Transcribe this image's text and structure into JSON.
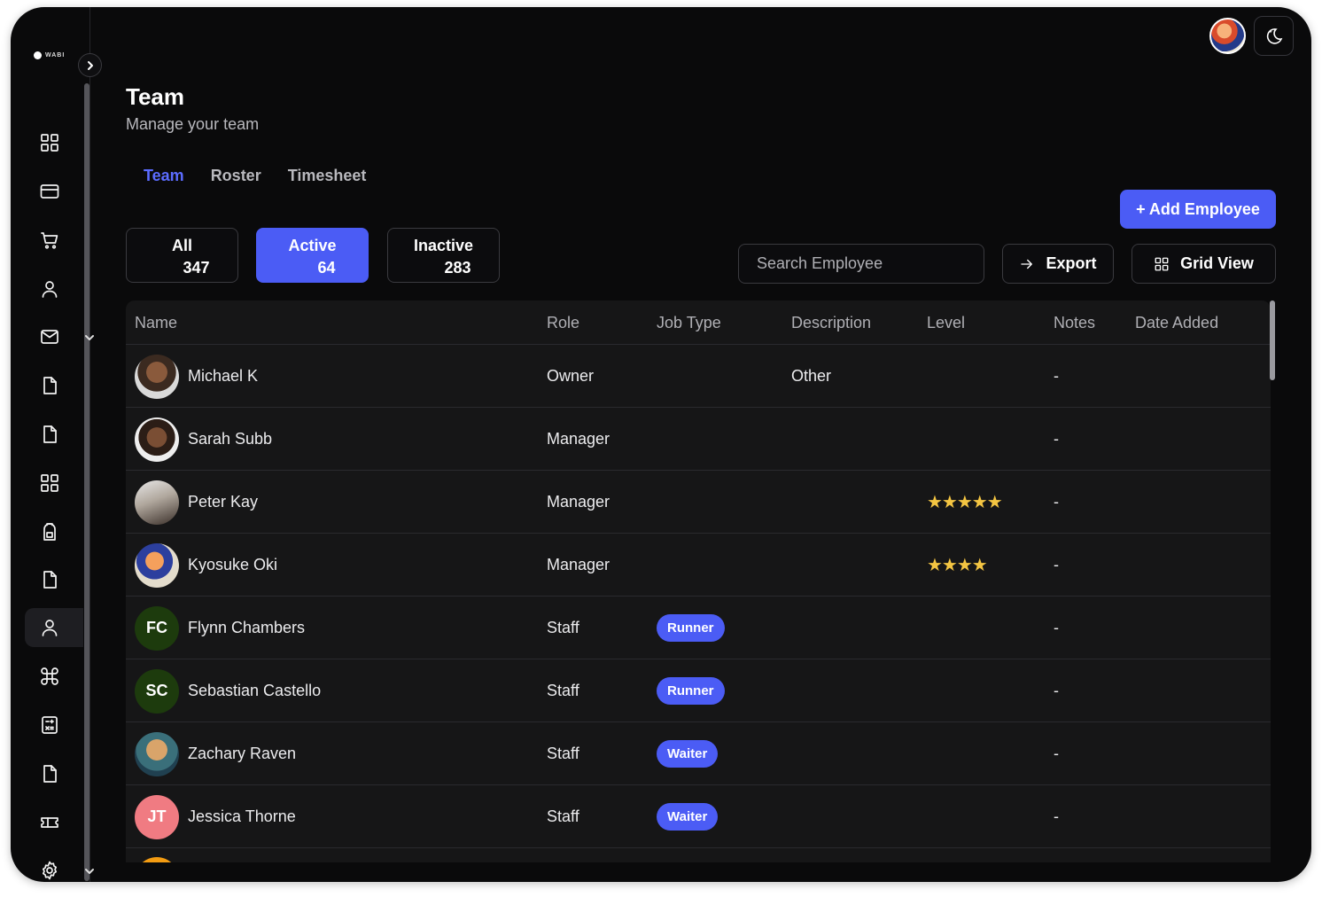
{
  "brand": {
    "logo_text": "WABI"
  },
  "header": {
    "title": "Team",
    "subtitle": "Manage your team"
  },
  "tabs": [
    {
      "label": "Team",
      "active": true
    },
    {
      "label": "Roster",
      "active": false
    },
    {
      "label": "Timesheet",
      "active": false
    }
  ],
  "filters": [
    {
      "label": "All",
      "count": "347",
      "active": false
    },
    {
      "label": "Active",
      "count": "64",
      "active": true
    },
    {
      "label": "Inactive",
      "count": "283",
      "active": false
    }
  ],
  "actions": {
    "add_employee": "+ Add Employee",
    "search_placeholder": "Search Employee",
    "export": "Export",
    "grid_view": "Grid View"
  },
  "table": {
    "columns": [
      "Name",
      "Role",
      "Job Type",
      "Description",
      "Level",
      "Notes",
      "Date Added"
    ],
    "rows": [
      {
        "name": "Michael K",
        "role": "Owner",
        "job_type": "",
        "description": "Other",
        "level": 0,
        "notes": "-",
        "date_added": "",
        "avatar": "photo",
        "initials": ""
      },
      {
        "name": "Sarah Subb",
        "role": "Manager",
        "job_type": "",
        "description": "",
        "level": 0,
        "notes": "-",
        "date_added": "",
        "avatar": "photo",
        "initials": ""
      },
      {
        "name": "Peter Kay",
        "role": "Manager",
        "job_type": "",
        "description": "",
        "level": 5,
        "notes": "-",
        "date_added": "",
        "avatar": "photo",
        "initials": ""
      },
      {
        "name": "Kyosuke Oki",
        "role": "Manager",
        "job_type": "",
        "description": "",
        "level": 4,
        "notes": "-",
        "date_added": "",
        "avatar": "photo",
        "initials": ""
      },
      {
        "name": "Flynn Chambers",
        "role": "Staff",
        "job_type": "Runner",
        "description": "",
        "level": 0,
        "notes": "-",
        "date_added": "",
        "avatar": "initials",
        "initials": "FC"
      },
      {
        "name": "Sebastian Castello",
        "role": "Staff",
        "job_type": "Runner",
        "description": "",
        "level": 0,
        "notes": "-",
        "date_added": "",
        "avatar": "initials",
        "initials": "SC"
      },
      {
        "name": "Zachary Raven",
        "role": "Staff",
        "job_type": "Waiter",
        "description": "",
        "level": 0,
        "notes": "-",
        "date_added": "",
        "avatar": "photo",
        "initials": ""
      },
      {
        "name": "Jessica Thorne",
        "role": "Staff",
        "job_type": "Waiter",
        "description": "",
        "level": 0,
        "notes": "-",
        "date_added": "",
        "avatar": "initials",
        "initials": "JT"
      }
    ]
  },
  "colors": {
    "accent": "#4b5cf5",
    "tab_active": "#5b6cff",
    "background": "#0a0a0b",
    "table_bg": "#161617",
    "star": "#f4c542"
  },
  "sidebar_icons": [
    "dashboard-icon",
    "card-icon",
    "cart-icon",
    "user-icon",
    "mail-icon",
    "file-icon",
    "file-icon",
    "dashboard-icon",
    "backpack-icon",
    "file-icon",
    "user-icon",
    "command-icon",
    "calculator-icon",
    "file-icon",
    "ticket-icon",
    "gear-icon"
  ]
}
